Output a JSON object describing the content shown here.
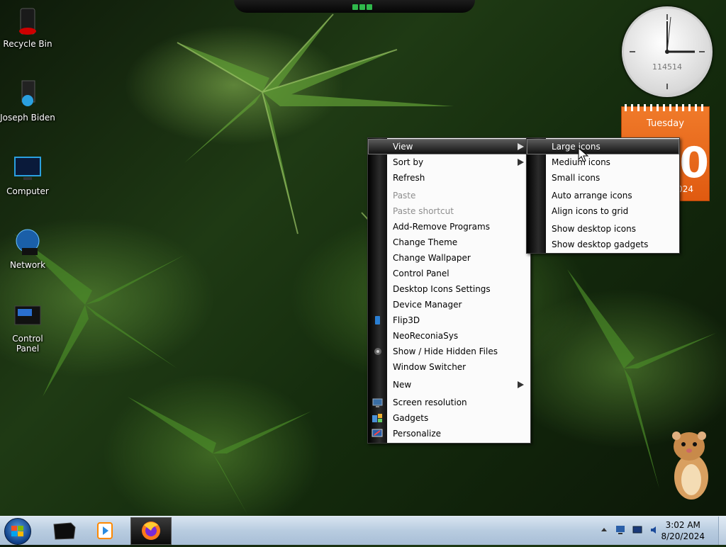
{
  "desktop": {
    "icons": [
      {
        "label": "Recycle Bin",
        "icon": "recycle-bin-icon"
      },
      {
        "label": "Joseph Biden",
        "icon": "user-folder-icon"
      },
      {
        "label": "Computer",
        "icon": "computer-icon"
      },
      {
        "label": "Network",
        "icon": "network-icon"
      },
      {
        "label": "Control Panel",
        "icon": "control-panel-icon"
      }
    ]
  },
  "gadgets": {
    "clock": {
      "number": "114514",
      "time": "3:02"
    },
    "calendar": {
      "weekday": "Tuesday",
      "day": "20",
      "year": "2024",
      "color": "#e8661c"
    }
  },
  "context_menu": {
    "items": [
      {
        "label": "View",
        "submenu": true,
        "highlighted": true
      },
      {
        "label": "Sort by",
        "submenu": true
      },
      {
        "label": "Refresh"
      },
      {
        "label": "Paste",
        "disabled": true
      },
      {
        "label": "Paste shortcut",
        "disabled": true
      },
      {
        "label": "Add-Remove Programs"
      },
      {
        "label": "Change Theme"
      },
      {
        "label": "Change Wallpaper"
      },
      {
        "label": "Control Panel"
      },
      {
        "label": "Desktop Icons Settings"
      },
      {
        "label": "Device Manager"
      },
      {
        "label": "Flip3D",
        "icon": "flip3d-icon"
      },
      {
        "label": "NeoReconiaSys"
      },
      {
        "label": "Show / Hide Hidden Files",
        "icon": "eye-icon"
      },
      {
        "label": "Window Switcher"
      },
      {
        "label": "New",
        "submenu": true
      },
      {
        "label": "Screen resolution",
        "icon": "display-icon"
      },
      {
        "label": "Gadgets",
        "icon": "gadgets-icon"
      },
      {
        "label": "Personalize",
        "icon": "personalize-icon"
      }
    ]
  },
  "view_submenu": {
    "items": [
      {
        "label": "Large icons",
        "highlighted": true
      },
      {
        "label": "Medium icons"
      },
      {
        "label": "Small icons"
      },
      {
        "label": "Auto arrange icons"
      },
      {
        "label": "Align icons to grid"
      },
      {
        "label": "Show desktop icons"
      },
      {
        "label": "Show desktop gadgets"
      }
    ]
  },
  "taskbar": {
    "pinned": [
      {
        "name": "start-button",
        "icon": "windows-logo-icon"
      },
      {
        "name": "taskbar-explorer",
        "icon": "black-box-icon"
      },
      {
        "name": "taskbar-media-player",
        "icon": "media-player-icon"
      },
      {
        "name": "taskbar-firefox",
        "icon": "firefox-icon",
        "active": true
      }
    ],
    "tray": {
      "time": "3:02 AM",
      "date": "8/20/2024",
      "icons": [
        "show-hidden-icons-arrow",
        "network-tray-icon",
        "display-tray-icon",
        "volume-tray-icon"
      ]
    }
  }
}
